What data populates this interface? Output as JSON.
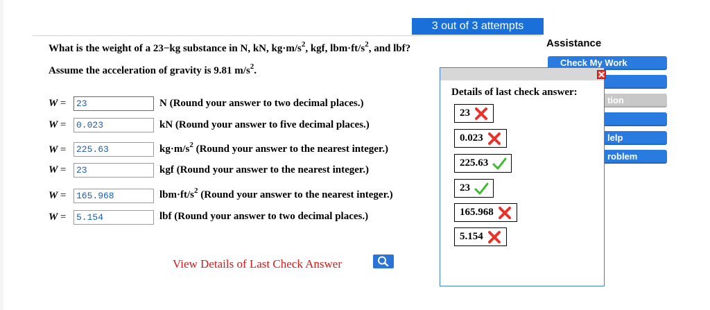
{
  "attempts_label": "3 out of 3 attempts",
  "question": {
    "line1": {
      "before": "What is the weight of a 23−kg substance in N, kN, kg·m/s",
      "sup1": "2",
      "mid": ", kgf, lbm·ft/s",
      "sup2": "2",
      "after": ", and lbf?"
    },
    "line2": {
      "before": "Assume the acceleration of gravity is 9.81 m/s",
      "sup": "2",
      "after": "."
    }
  },
  "rows": [
    {
      "var": "W",
      "eq": "=",
      "value": "23",
      "unit_before": "N (Round your answer to two decimal places.)",
      "unit_sup": "",
      "unit_after": ""
    },
    {
      "var": "W",
      "eq": "=",
      "value": "0.023",
      "unit_before": "kN (Round your answer to five decimal places.)",
      "unit_sup": "",
      "unit_after": ""
    },
    {
      "var": "W",
      "eq": "=",
      "value": "225.63",
      "unit_before": "kg·m/s",
      "unit_sup": "2",
      "unit_after": " (Round your answer to the nearest integer.)"
    },
    {
      "var": "W",
      "eq": "=",
      "value": "23",
      "unit_before": "kgf (Round your answer to the nearest integer.)",
      "unit_sup": "",
      "unit_after": ""
    },
    {
      "var": "W",
      "eq": "=",
      "value": "165.968",
      "unit_before": "lbm·ft/s",
      "unit_sup": "2",
      "unit_after": " (Round your answer to the nearest integer.)"
    },
    {
      "var": "W",
      "eq": "=",
      "value": "5.154",
      "unit_before": "lbf (Round your answer to two decimal places.)",
      "unit_sup": "",
      "unit_after": ""
    }
  ],
  "view_details_label": "View Details of Last Check Answer",
  "assistance": {
    "title": "Assistance",
    "buttons": [
      {
        "label": "Check My Work",
        "state": "active"
      },
      {
        "label": "",
        "state": "active"
      },
      {
        "label": "tion",
        "state": "disabled"
      },
      {
        "label": "",
        "state": "active"
      },
      {
        "label": "lelp",
        "state": "active"
      },
      {
        "label": "roblem",
        "state": "active"
      }
    ]
  },
  "details_popup": {
    "title": "Details of last check answer:",
    "answers": [
      {
        "value": "23",
        "result": "incorrect"
      },
      {
        "value": "0.023",
        "result": "incorrect"
      },
      {
        "value": "225.63",
        "result": "correct"
      },
      {
        "value": "23",
        "result": "correct"
      },
      {
        "value": "165.968",
        "result": "incorrect"
      },
      {
        "value": "5.154",
        "result": "incorrect"
      }
    ]
  },
  "colors": {
    "accent_blue": "#2a7be0",
    "incorrect_red": "#e8322a",
    "correct_green": "#3dbb2e",
    "link_red": "#d11a1a",
    "input_text": "#1a5bb0"
  }
}
